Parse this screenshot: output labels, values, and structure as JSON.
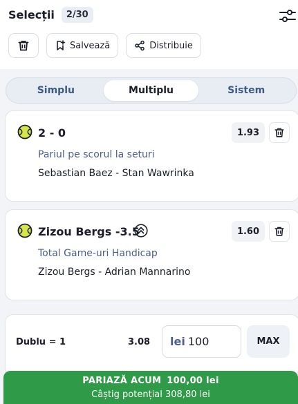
{
  "header": {
    "title": "Selecții",
    "count": "2/30",
    "settings_icon": "sliders-icon"
  },
  "actions": {
    "delete_icon": "trash-icon",
    "save_label": "Salvează",
    "save_icon": "bookmark-plus-icon",
    "share_label": "Distribuie",
    "share_icon": "share-icon"
  },
  "tabs": [
    {
      "label": "Simplu",
      "active": false
    },
    {
      "label": "Multiplu",
      "active": true
    },
    {
      "label": "Sistem",
      "active": false
    }
  ],
  "selections": [
    {
      "selection": "2 - 0",
      "market": "Pariul pe scorul la seturi",
      "event": "Sebastian Baez - Stan Wawrinka",
      "odds": "1.93",
      "sport_icon": "tennis-ball-icon",
      "boost": false
    },
    {
      "selection": "Zizou Bergs -3.5",
      "market": "Total Game-uri Handicap",
      "event": "Zizou Bergs - Adrian Mannarino",
      "odds": "1.60",
      "sport_icon": "tennis-ball-icon",
      "boost": true
    }
  ],
  "bet_summary": {
    "type_label": "Dublu = 1",
    "total_odds": "3.08",
    "currency": "lei",
    "stake": "100",
    "max_label": "MAX"
  },
  "place_bet": {
    "label": "PARIAZĂ ACUM",
    "amount": "100,00 lei",
    "potential": "Câștig potențial 308,80 lei"
  },
  "colors": {
    "accent_green": "#2f9a47",
    "tab_text": "#3e5a82",
    "market_text": "#4a5f8a",
    "tennis_ball": "#d4e64a"
  }
}
